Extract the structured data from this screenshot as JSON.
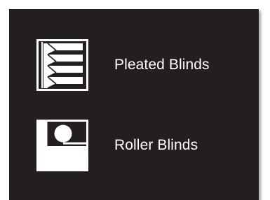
{
  "menu": {
    "items": [
      {
        "label": "Pleated Blinds",
        "icon": "pleated-blinds-icon"
      },
      {
        "label": "Roller Blinds",
        "icon": "roller-blinds-icon"
      }
    ]
  },
  "colors": {
    "panel_background": "#231f20",
    "foreground": "#ffffff"
  }
}
